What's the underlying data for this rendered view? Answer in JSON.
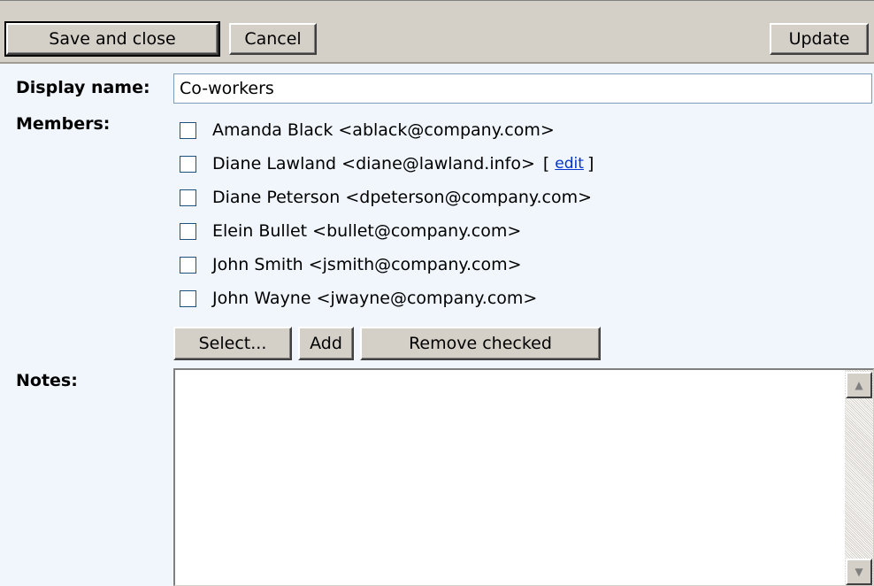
{
  "toolbar": {
    "save_close_label": "Save and close",
    "cancel_label": "Cancel",
    "update_label": "Update"
  },
  "form": {
    "display_name_label": "Display name:",
    "display_name_value": "Co-workers",
    "members_label": "Members:",
    "members": [
      {
        "text": "Amanda Black <ablack@company.com>",
        "checked": false
      },
      {
        "text": "Diane Lawland <diane@lawland.info>",
        "checked": false,
        "edit_prefix": "[",
        "edit_label": "edit",
        "edit_suffix": "]"
      },
      {
        "text": "Diane Peterson <dpeterson@company.com>",
        "checked": false
      },
      {
        "text": "Elein Bullet <bullet@company.com>",
        "checked": false
      },
      {
        "text": "John Smith <jsmith@company.com>",
        "checked": false
      },
      {
        "text": "John Wayne <jwayne@company.com>",
        "checked": false
      }
    ],
    "select_label": "Select...",
    "add_label": "Add",
    "remove_label": "Remove checked",
    "notes_label": "Notes:",
    "notes_value": ""
  },
  "icons": {
    "scroll_up": "scroll-up-arrow-icon",
    "scroll_down": "scroll-down-arrow-icon"
  },
  "colors": {
    "toolbar_bg": "#d4d0c8",
    "panel_bg": "#f0f6fc",
    "link": "#0033cc"
  }
}
